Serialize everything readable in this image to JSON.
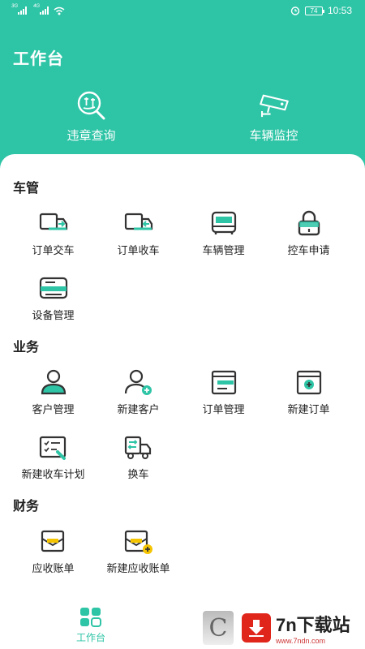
{
  "status_bar": {
    "sim1": "3G",
    "sim2": "4G",
    "battery": "74",
    "time": "10:53"
  },
  "header": {
    "title": "工作台"
  },
  "top_actions": [
    {
      "label": "违章查询",
      "icon": "violation-search-icon"
    },
    {
      "label": "车辆监控",
      "icon": "surveillance-camera-icon"
    }
  ],
  "sections": [
    {
      "title": "车管",
      "items": [
        {
          "label": "订单交车",
          "icon": "truck-deliver-icon"
        },
        {
          "label": "订单收车",
          "icon": "truck-receive-icon"
        },
        {
          "label": "车辆管理",
          "icon": "bus-icon"
        },
        {
          "label": "控车申请",
          "icon": "lock-icon"
        },
        {
          "label": "设备管理",
          "icon": "device-icon"
        }
      ]
    },
    {
      "title": "业务",
      "items": [
        {
          "label": "客户管理",
          "icon": "customer-icon"
        },
        {
          "label": "新建客户",
          "icon": "add-customer-icon"
        },
        {
          "label": "订单管理",
          "icon": "order-icon"
        },
        {
          "label": "新建订单",
          "icon": "new-order-icon"
        },
        {
          "label": "新建收车计划",
          "icon": "plan-icon"
        },
        {
          "label": "换车",
          "icon": "swap-car-icon"
        }
      ]
    },
    {
      "title": "财务",
      "items": [
        {
          "label": "应收账单",
          "icon": "bill-icon"
        },
        {
          "label": "新建应收账单",
          "icon": "new-bill-icon"
        }
      ]
    }
  ],
  "tabbar": {
    "home_label": "工作台"
  },
  "watermark": {
    "brand": "7n下载站",
    "url": "www.7ndn.com"
  },
  "colors": {
    "accent": "#2ec4a6",
    "accent_dark": "#1a9c84",
    "yellow": "#f5c400"
  }
}
